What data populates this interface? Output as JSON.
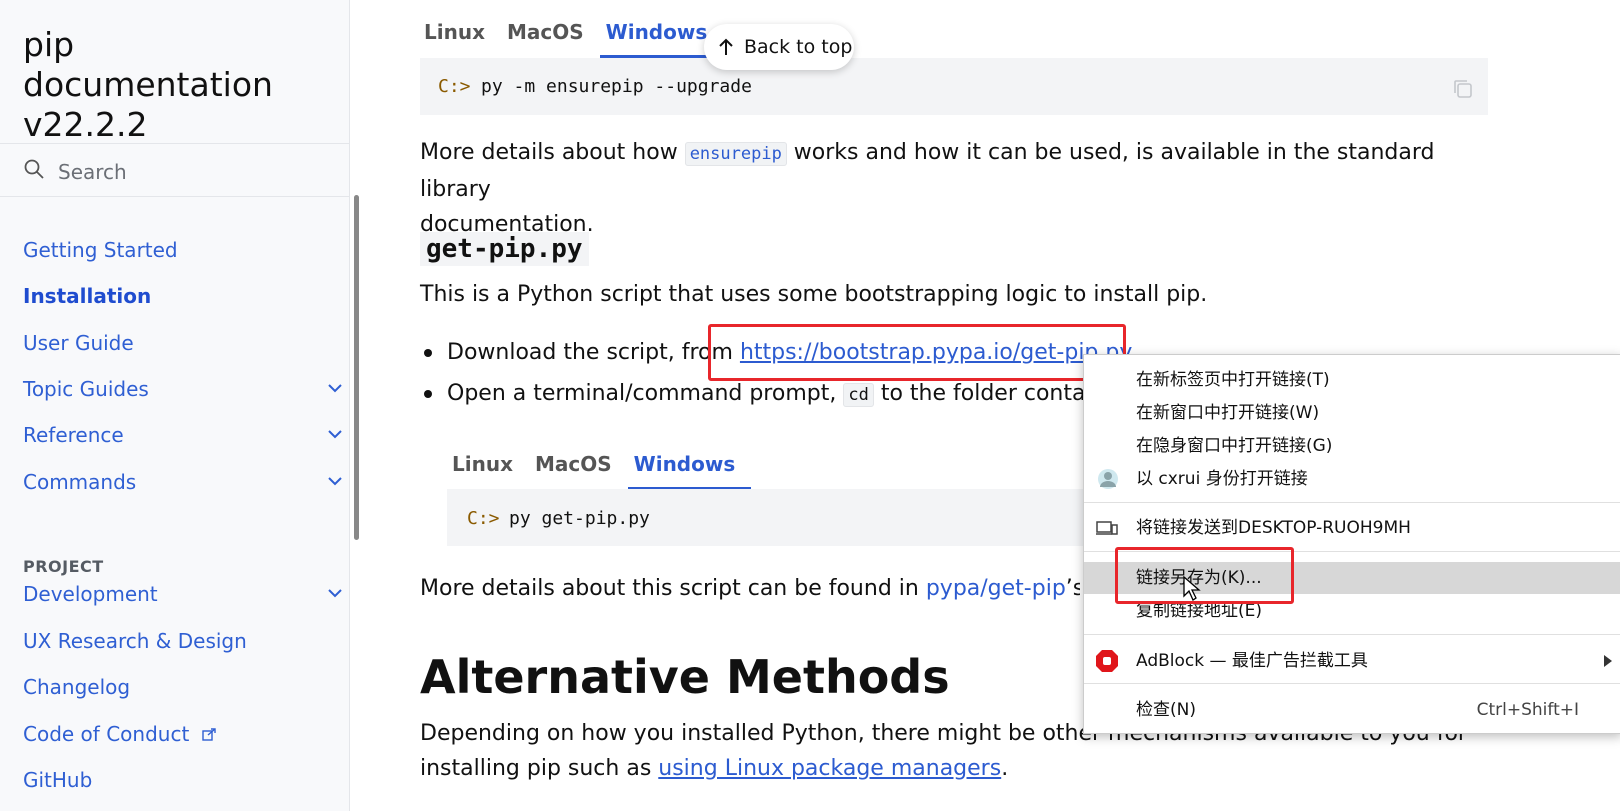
{
  "sidebar": {
    "title": "pip documentation v22.2.2",
    "search_placeholder": "Search",
    "nav": [
      {
        "label": "Getting Started"
      },
      {
        "label": "Installation"
      },
      {
        "label": "User Guide"
      },
      {
        "label": "Topic Guides"
      },
      {
        "label": "Reference"
      },
      {
        "label": "Commands"
      }
    ],
    "project_label": "PROJECT",
    "project_nav": [
      {
        "label": "Development"
      },
      {
        "label": "UX Research & Design"
      },
      {
        "label": "Changelog"
      },
      {
        "label": "Code of Conduct"
      },
      {
        "label": "GitHub"
      }
    ]
  },
  "content": {
    "tabs1": [
      "Linux",
      "MacOS",
      "Windows"
    ],
    "code1": {
      "prompt": "C:>",
      "command": "py -m ensurepip --upgrade"
    },
    "back_to_top": "Back to top",
    "p1_a": "More details about how ",
    "p1_code": "ensurepip",
    "p1_b": " works and how it can be used, is available in the standard library",
    "p1_c": "documentation.",
    "heading_getpip": "get-pip.py",
    "p2": "This is a Python script that uses some bootstrapping logic to install pip.",
    "bullet1_a": "Download the script, from ",
    "bullet1_link": "https://bootstrap.pypa.io/get-pip.py",
    "bullet2_a": "Open a terminal/command prompt, ",
    "bullet2_code": "cd",
    "bullet2_b": " to the folder containin",
    "tabs2": [
      "Linux",
      "MacOS",
      "Windows"
    ],
    "code2": {
      "prompt": "C:>",
      "command": "py get-pip.py"
    },
    "p3_a": "More details about this script can be found in ",
    "p3_link": "pypa/get-pip",
    "p3_b": "’s REA",
    "heading_alt": "Alternative Methods",
    "p4_a": "Depending on how you installed Python, there might be other mechanisms available to you for",
    "p4_b": "installing pip such as ",
    "p4_link": "using Linux package managers",
    "p4_c": "."
  },
  "context_menu": {
    "items": [
      {
        "label": "在新标签页中打开链接(T)"
      },
      {
        "label": "在新窗口中打开链接(W)"
      },
      {
        "label": "在隐身窗口中打开链接(G)"
      },
      {
        "label": "以 cxrui 身份打开链接"
      },
      {
        "label": "将链接发送到DESKTOP-RUOH9MH"
      },
      {
        "label": "链接另存为(K)..."
      },
      {
        "label": "复制链接地址(E)"
      },
      {
        "label": "AdBlock — 最佳广告拦截工具"
      },
      {
        "label": "检查(N)",
        "shortcut": "Ctrl+Shift+I"
      }
    ]
  },
  "colors": {
    "accent": "#2c5bd0",
    "highlight_box": "#e8262b",
    "adblock": "#e0161b"
  }
}
